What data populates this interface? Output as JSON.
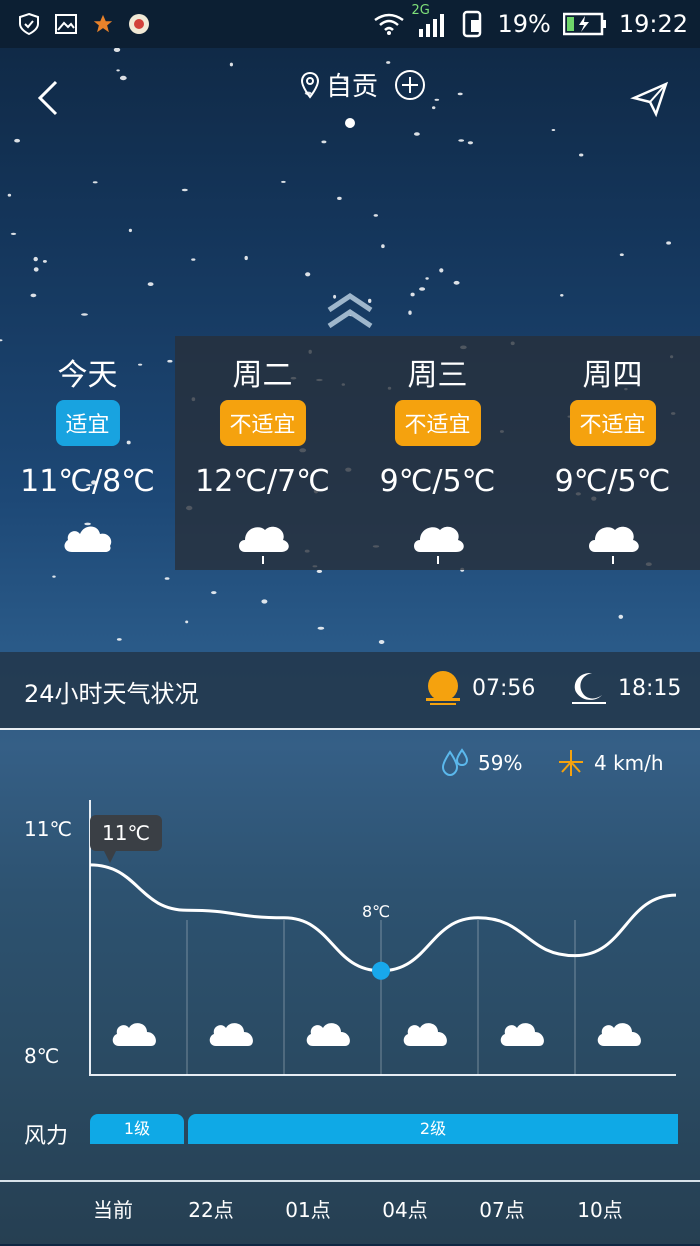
{
  "status": {
    "battery": "19%",
    "time": "19:22",
    "network": "2G"
  },
  "header": {
    "city": "自贡"
  },
  "days": [
    {
      "name": "今天",
      "badge": "适宜",
      "temp": "11℃/8℃",
      "icon": "cloud-icon",
      "dark": false
    },
    {
      "name": "周二",
      "badge": "不适宜",
      "temp": "12℃/7℃",
      "icon": "rain-cloud-icon",
      "dark": true
    },
    {
      "name": "周三",
      "badge": "不适宜",
      "temp": "9℃/5℃",
      "icon": "rain-cloud-icon",
      "dark": true
    },
    {
      "name": "周四",
      "badge": "不适宜",
      "temp": "9℃/5℃",
      "icon": "rain-cloud-icon",
      "dark": true
    }
  ],
  "panel24": {
    "title": "24小时天气状况",
    "sunrise": "07:56",
    "sunset": "18:15",
    "humidity": "59%",
    "wind_speed": "4 km/h"
  },
  "chart_data": {
    "type": "line",
    "ymax_label": "11℃",
    "ymin_label": "8℃",
    "tooltip": "11℃",
    "min_point_label": "8℃",
    "x": [
      "当前",
      "22点",
      "01点",
      "04点",
      "07点",
      "10点"
    ],
    "temps": [
      10.5,
      9.9,
      9.8,
      9.1,
      9.8,
      9.3,
      10.1
    ],
    "icons": [
      "cloud-icon",
      "cloud-icon",
      "cloud-icon",
      "cloud-icon",
      "cloud-icon",
      "cloud-icon"
    ]
  },
  "wind": {
    "label": "风力",
    "levels": [
      "1级",
      "2级"
    ]
  },
  "timeline": [
    "当前",
    "22点",
    "01点",
    "04点",
    "07点",
    "10点"
  ]
}
